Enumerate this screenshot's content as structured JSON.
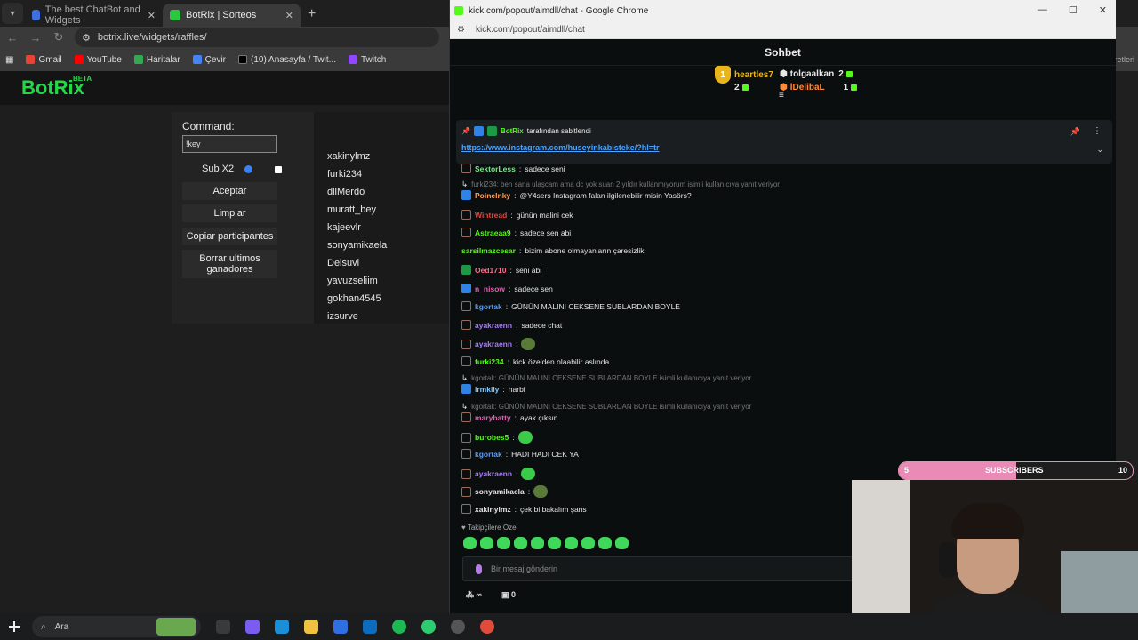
{
  "left_browser": {
    "tabs": [
      {
        "title": "The best ChatBot and Widgets"
      },
      {
        "title": "BotRix | Sorteos"
      }
    ],
    "url": "botrix.live/widgets/raffles/",
    "bookmarks": [
      "Gmail",
      "YouTube",
      "Haritalar",
      "Çevir",
      "(10) Anasayfa / Twit...",
      "Twitch"
    ],
    "bookmarks_extra": "Tüm Yer İşaretleri"
  },
  "botrix": {
    "logo": "BotRix",
    "beta": "BETA",
    "command_label": "Command:",
    "command_value": "!key",
    "sub_label": "Sub X2",
    "buttons": {
      "accept": "Aceptar",
      "clear": "Limpiar",
      "copy": "Copiar participantes",
      "delete": "Borrar ultimos ganadores"
    },
    "participants": [
      "xakinylmz",
      "furki234",
      "dllMerdo",
      "muratt_bey",
      "kajeevlr",
      "sonyamikaela",
      "Deisuvl",
      "yavuzseliim",
      "gokhan4545",
      "izsurve"
    ]
  },
  "chat_window": {
    "title": "kick.com/popout/aimdll/chat - Google Chrome",
    "url": "kick.com/popout/aimdll/chat",
    "header": "Sohbet",
    "leaderboard": {
      "first": {
        "rank": "1",
        "name": "heartles7",
        "count": "2"
      },
      "second": {
        "name": "tolgaalkan",
        "count": "2"
      },
      "third": {
        "name": "lDelibaL",
        "count": "1"
      }
    },
    "pinned": {
      "by_user": "BotRix",
      "by_text": "tarafından sabitlendi",
      "link": "https://www.instagram.com/huseyinkabisteke/?hl=tr"
    },
    "messages": [
      {
        "user": "SektorLess",
        "color": "#7ee787",
        "text": "sadece seni",
        "badge": "sub"
      },
      {
        "reply": "furki234: ben sana ulaşcam ama dc yok suan 2 yıldır kullanmıyorum isimli kullanıcıya yanıt veriyor"
      },
      {
        "user": "Poinelnky",
        "color": "#ff9f5a",
        "text": "@Y4sers Instagram falan ilgilenebilir misin Yasörs?",
        "badge": "vip"
      },
      {
        "user": "Wintread",
        "color": "#e0453e",
        "text": "günün malini cek",
        "badge": "sub"
      },
      {
        "user": "Astraeaa9",
        "color": "#53fc18",
        "text": "sadece sen abi",
        "badge": "sub"
      },
      {
        "user": "sarsilmazcesar",
        "color": "#53fc18",
        "text": "bizim abone olmayanların çaresizlik"
      },
      {
        "user": "Oed1710",
        "color": "#ff6b8a",
        "text": "seni abi",
        "badge": "mod"
      },
      {
        "user": "n_nisow",
        "color": "#e25eb0",
        "text": "sadece sen",
        "badge": "vip"
      },
      {
        "user": "kgortak",
        "color": "#5b9cf6",
        "text": "GÜNÜN MALINI CEKSENE SUBLARDAN BOYLE",
        "badge": "sub"
      },
      {
        "user": "ayakraenn",
        "color": "#a67bf5",
        "text": "sadece chat",
        "badge": "sub"
      },
      {
        "user": "ayakraenn",
        "color": "#a67bf5",
        "text": "",
        "badge": "sub",
        "emote": true
      },
      {
        "user": "furki234",
        "color": "#53fc18",
        "text": "kick özelden olaabilir aslında",
        "badge": "sub"
      },
      {
        "reply": "kgortak: GÜNÜN MALINI CEKSENE SUBLARDAN BOYLE isimli kullanıcıya yanıt veriyor"
      },
      {
        "user": "irmkily",
        "color": "#7ec8ff",
        "text": "harbi",
        "badge": "vip"
      },
      {
        "reply": "kgortak: GÜNÜN MALINI CEKSENE SUBLARDAN BOYLE isimli kullanıcıya yanıt veriyor"
      },
      {
        "user": "marybatty",
        "color": "#e25eb0",
        "text": "ayak çıksın",
        "badge": "sub"
      },
      {
        "user": "burobes5",
        "color": "#53fc18",
        "text": "",
        "badge": "sub",
        "emote": true
      },
      {
        "user": "kgortak",
        "color": "#5b9cf6",
        "text": "HADI HADI CEK YA",
        "badge": "sub"
      },
      {
        "user": "ayakraenn",
        "color": "#a67bf5",
        "text": "",
        "badge": "sub",
        "emote": true
      },
      {
        "user": "sonyamikaela",
        "color": "#e6e6e6",
        "text": "",
        "badge": "sub",
        "emote": true
      },
      {
        "user": "xakinylmz",
        "color": "#e6e6e6",
        "text": "çek bi bakalım şans",
        "badge": "sub"
      }
    ],
    "followers_only": "Takipçilere Özel",
    "input_placeholder": "Bir mesaj gönderin",
    "infinity": "∞",
    "count": "0"
  },
  "overlay": {
    "sub_current": "5",
    "sub_label": "SUBSCRIBERS",
    "sub_goal": "10",
    "sub_progress": 0.5
  },
  "taskbar": {
    "search_label": "Ara"
  }
}
